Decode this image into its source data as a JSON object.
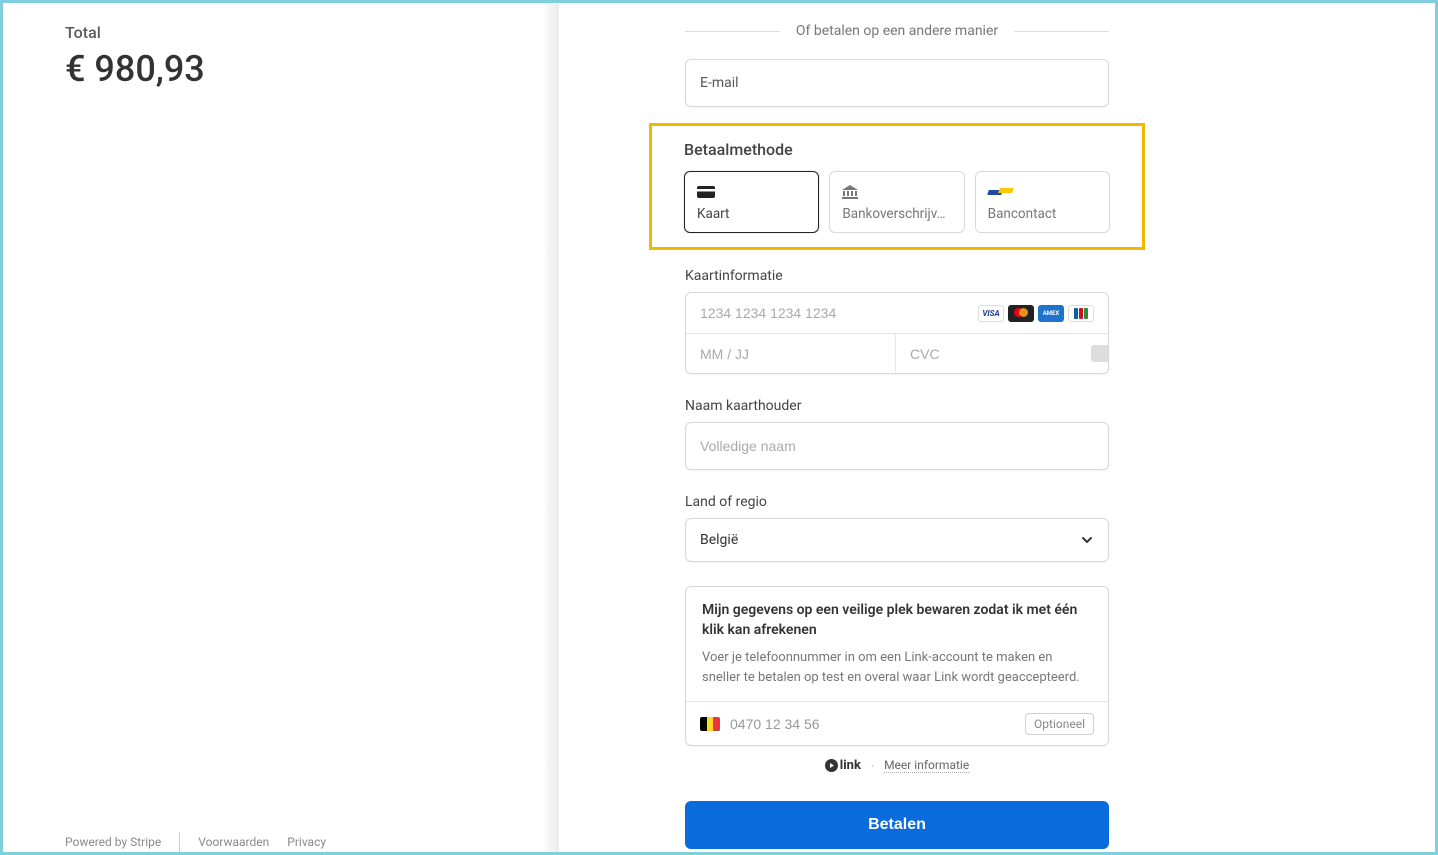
{
  "summary": {
    "total_label": "Total",
    "total_amount": "€ 980,93"
  },
  "alt_pay_text": "Of betalen op een andere manier",
  "email": {
    "label": "E-mail",
    "value": ""
  },
  "payment_method": {
    "title": "Betaalmethode",
    "options": {
      "card": "Kaart",
      "bank": "Bankoverschrijv…",
      "bancontact": "Bancontact"
    }
  },
  "card_info": {
    "title": "Kaartinformatie",
    "number_placeholder": "1234 1234 1234 1234",
    "expiry_placeholder": "MM / JJ",
    "cvc_placeholder": "CVC"
  },
  "brands": {
    "visa": "VISA",
    "amex": "AMEX"
  },
  "cardholder": {
    "title": "Naam kaarthouder",
    "placeholder": "Volledige naam"
  },
  "region": {
    "title": "Land of regio",
    "selected": "België"
  },
  "link": {
    "title": "Mijn gegevens op een veilige plek bewaren zodat ik met één klik kan afrekenen",
    "desc": "Voer je telefoonnummer in om een Link-account te maken en sneller te betalen op test en overal waar Link wordt geaccepteerd.",
    "phone_placeholder": "0470 12 34 56",
    "optional": "Optioneel",
    "brand": "link",
    "more": "Meer informatie"
  },
  "pay_button": "Betalen",
  "footer": {
    "powered": "Powered by Stripe",
    "terms": "Voorwaarden",
    "privacy": "Privacy"
  }
}
